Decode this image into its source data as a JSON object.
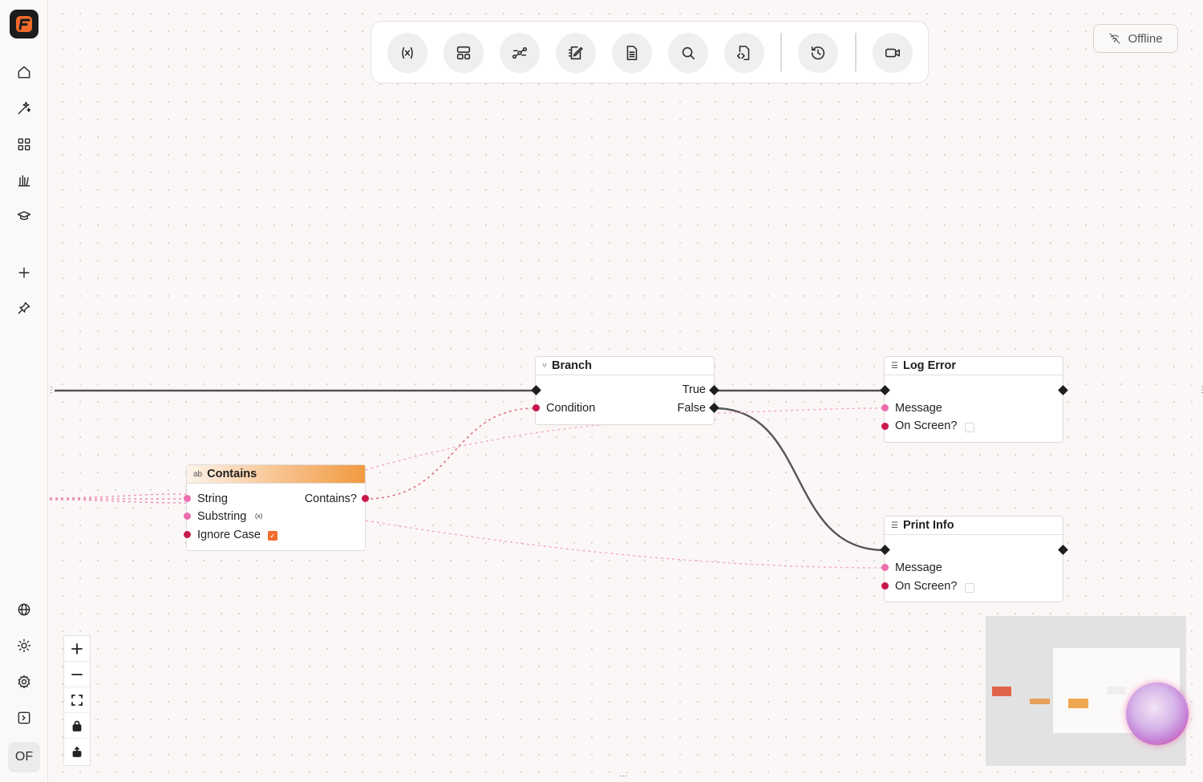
{
  "sidebar": {
    "items": [
      {
        "name": "home",
        "icon": "home-icon"
      },
      {
        "name": "sparkles",
        "icon": "sparkles-icon"
      },
      {
        "name": "apps",
        "icon": "grid-icon"
      },
      {
        "name": "library",
        "icon": "library-icon"
      },
      {
        "name": "learn",
        "icon": "graduation-cap-icon"
      },
      {
        "name": "add",
        "icon": "plus-icon"
      },
      {
        "name": "pin",
        "icon": "pin-icon"
      }
    ],
    "bottom": [
      {
        "name": "language",
        "icon": "globe-icon"
      },
      {
        "name": "theme",
        "icon": "sun-icon"
      },
      {
        "name": "settings",
        "icon": "gear-icon"
      },
      {
        "name": "collapse",
        "icon": "sidebar-toggle-icon"
      }
    ],
    "avatar_initials": "OF"
  },
  "toolbar": {
    "buttons": [
      "variables-icon",
      "layout-icon",
      "connect-icon",
      "edit-notes-icon",
      "document-icon",
      "search-icon",
      "code-file-icon",
      "history-icon",
      "record-video-icon"
    ]
  },
  "status": {
    "offline_label": "Offline"
  },
  "nodes": {
    "branch": {
      "title": "Branch",
      "icon": "⑂",
      "true_label": "True",
      "condition_label": "Condition",
      "false_label": "False"
    },
    "log_error": {
      "title": "Log Error",
      "icon": "☰",
      "message_label": "Message",
      "on_screen_label": "On Screen?",
      "on_screen_checked": false
    },
    "contains": {
      "title": "Contains",
      "icon": "ab",
      "string_label": "String",
      "substring_label": "Substring",
      "substring_icon": "(x)",
      "ignore_case_label": "Ignore Case",
      "ignore_case_checked": true,
      "output_label": "Contains?"
    },
    "print_info": {
      "title": "Print Info",
      "icon": "☰",
      "message_label": "Message",
      "on_screen_label": "On Screen?",
      "on_screen_checked": false
    }
  },
  "zoom_controls": [
    "zoom-in-icon",
    "zoom-out-icon",
    "fit-view-icon",
    "lock-icon",
    "unlock-icon"
  ],
  "colors": {
    "accent": "#f26a2e",
    "contains_header": "#f3a04d",
    "pin_pink": "#ee6fae",
    "pin_red": "#c8184a",
    "exec_wire": "#555555",
    "data_wire": "#ec8eb5"
  }
}
